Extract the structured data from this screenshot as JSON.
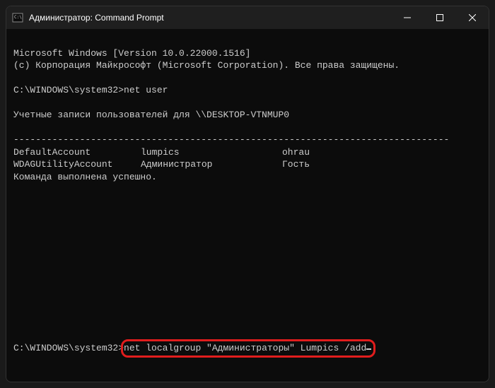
{
  "titlebar": {
    "title": "Администратор: Command Prompt"
  },
  "output": {
    "line1": "Microsoft Windows [Version 10.0.22000.1516]",
    "line2": "(c) Корпорация Майкрософт (Microsoft Corporation). Все права защищены.",
    "prompt1": "C:\\WINDOWS\\system32>",
    "command1": "net user",
    "heading": "Учетные записи пользователей для \\\\DESKTOP-VTNMUP0",
    "separator": "-------------------------------------------------------------------------------",
    "row1": {
      "c1": "DefaultAccount",
      "c2": "lumpics",
      "c3": "ohrau"
    },
    "row2": {
      "c1": "WDAGUtilityAccount",
      "c2": "Администратор",
      "c3": "Гость"
    },
    "success": "Команда выполнена успешно.",
    "prompt2": "C:\\WINDOWS\\system32>",
    "command2": "net localgroup \"Администраторы\" Lumpics /add"
  }
}
